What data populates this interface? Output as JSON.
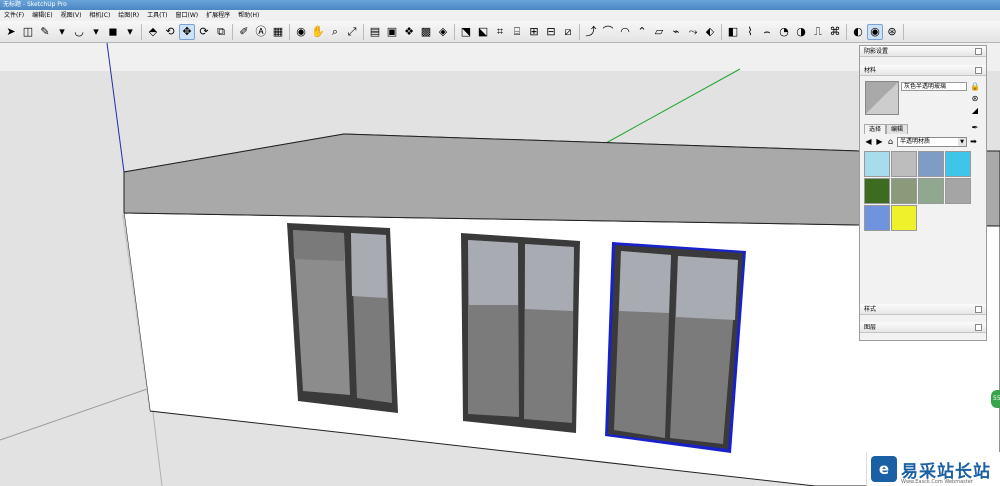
{
  "window": {
    "title": "无标题 - SketchUp Pro"
  },
  "menu": [
    "文件(F)",
    "编辑(E)",
    "视图(V)",
    "相机(C)",
    "绘图(R)",
    "工具(T)",
    "窗口(W)",
    "扩展程序",
    "帮助(H)"
  ],
  "toolbar": {
    "groups": [
      [
        "➤",
        "◫",
        "✎",
        "▾",
        "◡",
        "▾",
        "◼",
        "▾"
      ],
      [
        "⬘",
        "⟲",
        "✥",
        "⟳",
        "⧉"
      ],
      [
        "✐",
        "Ⓐ",
        "▦"
      ],
      [
        "◉",
        "✋",
        "⌕",
        "⤢"
      ],
      [
        "▤",
        "▣",
        "❖",
        "▩",
        "◈"
      ],
      [
        "⬔",
        "⬕",
        "⌗",
        "⌸",
        "⊞",
        "⊟",
        "⧄"
      ],
      [
        "⤴",
        "⌒",
        "◠",
        "⌃",
        "▱",
        "⌁",
        "⤳",
        "⬖"
      ],
      [
        "◧",
        "⌇",
        "⌢",
        "◔",
        "◑",
        "⎍",
        "⌘"
      ],
      [
        "◐",
        "◉",
        "⊛"
      ]
    ]
  },
  "trays": {
    "shadow_settings": "阴影设置",
    "materials": {
      "title": "材料",
      "current_material": "灰色半透明玻璃",
      "tabs": [
        "选择",
        "编辑"
      ],
      "library": "半透明材质",
      "swatch_colors": [
        "#a7dcec",
        "#bdbdbd",
        "#7f9cc6",
        "#3ec5ea",
        "#3d6b1f",
        "#8a9a7a",
        "#8fa88f",
        "#a5a5a5",
        "#6f93df",
        "#eef22b"
      ]
    },
    "styles": "样式",
    "layers": "图层"
  },
  "watermark": {
    "text": "易采站长站",
    "logo": "e",
    "sub": "Www.Easck.Com  Webmaster"
  },
  "badge_text": "55",
  "colors": {
    "axis_blue": "#1f2fa8",
    "axis_green": "#1ea62f",
    "selection_blue": "#1822c8"
  }
}
